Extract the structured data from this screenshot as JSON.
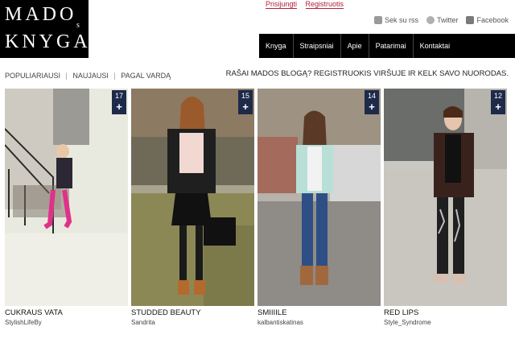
{
  "logo": {
    "row1": "MADO",
    "row2": "KNYGA",
    "s": "s"
  },
  "auth": {
    "login": "Prisijungti",
    "register": "Registruotis"
  },
  "social": [
    {
      "icon": "rss-icon",
      "label": "Sek su rss"
    },
    {
      "icon": "twitter-icon",
      "label": "Twitter"
    },
    {
      "icon": "facebook-icon",
      "label": "Facebook"
    }
  ],
  "nav": [
    "Knyga",
    "Straipsniai",
    "Apie",
    "Patarimai",
    "Kontaktai"
  ],
  "filters": [
    "POPULIARIAUSI",
    "NAUJAUSI",
    "PAGAL VARDĄ"
  ],
  "promo": "RAŠAI MADOS BLOGĄ? REGISTRUOKIS VIRŠUJE IR KELK SAVO NUORODAS.",
  "cards": [
    {
      "count": "17",
      "plus": "+",
      "title": "CUKRAUS VATA",
      "author": "StylishLifeBy"
    },
    {
      "count": "15",
      "plus": "+",
      "title": "STUDDED BEAUTY",
      "author": "Sandrita"
    },
    {
      "count": "14",
      "plus": "+",
      "title": "SMIIIILE",
      "author": "kalbantiskatinas"
    },
    {
      "count": "12",
      "plus": "+",
      "title": "RED LIPS",
      "author": "Style_Syndrome"
    }
  ]
}
